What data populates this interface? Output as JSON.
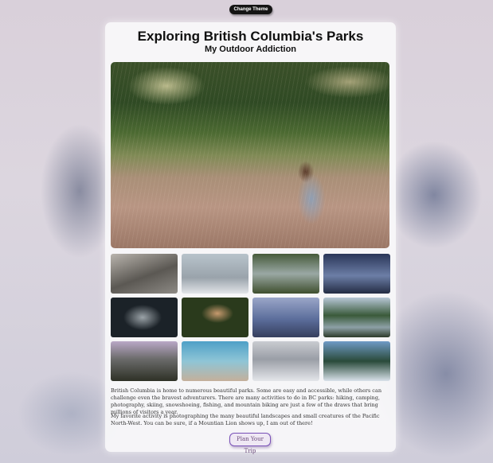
{
  "header": {
    "theme_button_label": "Change Theme"
  },
  "card": {
    "title": "Exploring British Columbia's Parks",
    "subtitle": "My Outdoor Addiction",
    "paragraphs": [
      "British Columbia is home to numerous beautiful parks. Some are easy and accessible, while others can challenge even the bravest adventurers. There are many activities to do in BC parks: hiking, camping, photography, skiing, snowshoeing, fishing, and mountain biking are just a few of the draws that bring millions of visitors a year.",
      "My favorite activity is photographing the many beautiful landscapes and small creatures of the Pacific North-West. You can be sure, if a Mountian Lion shows up, I am out of there!"
    ],
    "plan_button_label": "Plan Your Trip"
  },
  "colors": {
    "accent": "#7a52b8",
    "theme_button_bg": "#141414"
  }
}
